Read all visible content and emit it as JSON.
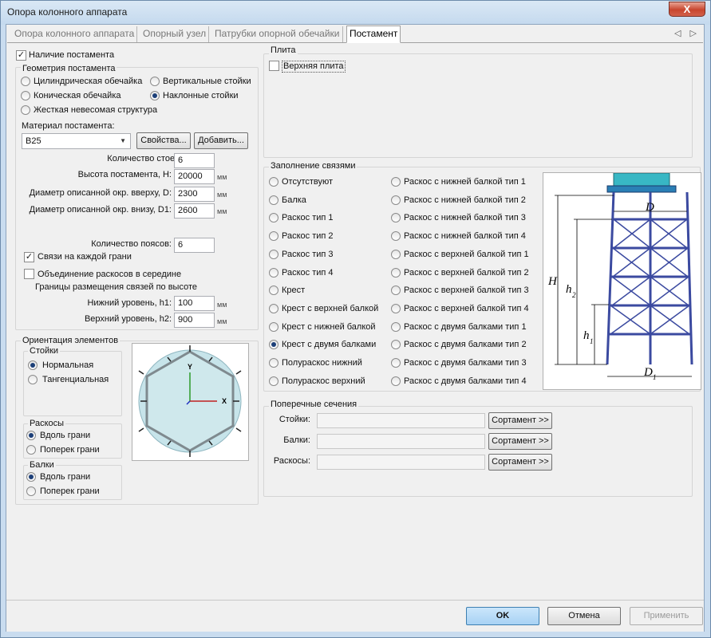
{
  "window": {
    "title": "Опора колонного аппарата",
    "close": "X"
  },
  "tabs": [
    "Опора колонного аппарата",
    "Опорный узел",
    "Патрубки опорной обечайки",
    "Постамент"
  ],
  "tab_arrows": "◁ ▷",
  "left": {
    "has_pedestal_label": "Наличие постамента",
    "geometry_title": "Геометрия постамента",
    "geometry_options": [
      "Цилиндрическая обечайка",
      "Вертикальные стойки",
      "Коническая обечайка",
      "Наклонные стойки",
      "Жесткая невесомая структура"
    ],
    "material_label": "Материал постамента:",
    "material_value": "B25",
    "properties_btn": "Свойства...",
    "add_btn": "Добавить...",
    "fields": [
      {
        "label": "Количество стоек, N:",
        "value": "6",
        "unit": ""
      },
      {
        "label": "Высота постамента, H:",
        "value": "20000",
        "unit": "мм"
      },
      {
        "label": "Диаметр описанной окр. вверху, D:",
        "value": "2300",
        "unit": "мм"
      },
      {
        "label": "Диаметр описанной окр. внизу, D1:",
        "value": "2600",
        "unit": "мм"
      }
    ],
    "belts_label": "Количество поясов:",
    "belts_value": "6",
    "each_face_label": "Связи на каждой грани",
    "merge_label": "Объединение раскосов в середине",
    "bounds_label": "Границы размещения связей по высоте",
    "lower_label": "Нижний уровень, h1:",
    "lower_value": "100",
    "upper_label": "Верхний уровень, h2:",
    "upper_value": "900",
    "unit_mm": "мм"
  },
  "orientation": {
    "title": "Ориентация элементов",
    "posts_title": "Стойки",
    "posts": [
      "Нормальная",
      "Тангенциальная"
    ],
    "braces_title": "Раскосы",
    "braces": [
      "Вдоль грани",
      "Поперек грани"
    ],
    "beams_title": "Балки",
    "beams": [
      "Вдоль грани",
      "Поперек грани"
    ],
    "axis_y": "Y",
    "axis_x": "X"
  },
  "plate": {
    "title": "Плита",
    "top_plate": "Верхняя плита"
  },
  "bracing": {
    "title": "Заполнение связями",
    "col1": [
      "Отсутствуют",
      "Балка",
      "Раскос тип 1",
      "Раскос тип 2",
      "Раскос тип 3",
      "Раскос тип 4",
      "Крест",
      "Крест с верхней балкой",
      "Крест с нижней балкой",
      "Крест с двумя балками",
      "Полураскос нижний",
      "Полураскос верхний"
    ],
    "col2": [
      "Раскос с нижней балкой тип 1",
      "Раскос с нижней балкой тип 2",
      "Раскос с нижней балкой тип 3",
      "Раскос с нижней балкой тип 4",
      "Раскос с верхней балкой тип 1",
      "Раскос с верхней балкой тип 2",
      "Раскос с верхней балкой тип 3",
      "Раскос с верхней балкой тип 4",
      "Раскос с двумя балками тип 1",
      "Раскос с двумя балками тип 2",
      "Раскос с двумя балками тип 3",
      "Раскос с двумя балками тип 4"
    ],
    "diagram_labels": {
      "D": "D",
      "H": "H",
      "h2": "h",
      "h2_sub": "2",
      "h1": "h",
      "h1_sub": "1",
      "D1": "D",
      "D1_sub": "1"
    }
  },
  "sections": {
    "title": "Поперечные сечения",
    "rows": [
      {
        "label": "Стойки:",
        "button": "Сортамент >>"
      },
      {
        "label": "Балки:",
        "button": "Сортамент >>"
      },
      {
        "label": "Раскосы:",
        "button": "Сортамент >>"
      }
    ]
  },
  "footer": {
    "ok": "OK",
    "cancel": "Отмена",
    "apply": "Применить"
  },
  "colors": {
    "frame": "#c9dcef",
    "ok_bg": "#a8d2f4",
    "radio_dot": "#1c3f78",
    "tower_tube": "#3b4aa0",
    "tank_cyan": "#38b7c4"
  }
}
